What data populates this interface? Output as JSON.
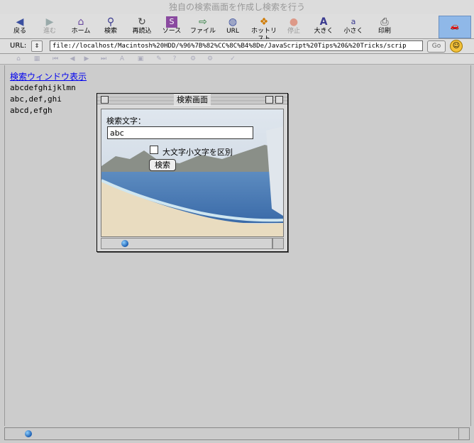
{
  "window": {
    "title": "独自の検索画面を作成し検索を行う"
  },
  "toolbar": {
    "buttons": [
      {
        "label": "戻る",
        "icon": "back-arrow-icon"
      },
      {
        "label": "進む",
        "icon": "forward-arrow-icon"
      },
      {
        "label": "ホーム",
        "icon": "home-icon"
      },
      {
        "label": "検索",
        "icon": "search-icon"
      },
      {
        "label": "再読込",
        "icon": "reload-icon"
      },
      {
        "label": "ソース",
        "icon": "source-icon"
      },
      {
        "label": "ファイル",
        "icon": "file-icon"
      },
      {
        "label": "URL",
        "icon": "url-icon"
      },
      {
        "label": "ホットリスト",
        "icon": "hotlist-icon"
      },
      {
        "label": "停止",
        "icon": "stop-icon"
      },
      {
        "label": "大きく",
        "icon": "bigger-icon"
      },
      {
        "label": "小さく",
        "icon": "smaller-icon"
      },
      {
        "label": "印刷",
        "icon": "print-icon"
      }
    ]
  },
  "urlbar": {
    "label": "URL:",
    "value": "file://localhost/Macintosh%20HDD/%96%7B%82%CC%8C%B4%8De/JavaScript%20Tips%20&%20Tricks/scrip",
    "go_label": "Go"
  },
  "page": {
    "link_text": "検索ウィンドウ表示",
    "lines": [
      "abcdefghijklmn",
      "abc,def,ghi",
      "abcd,efgh"
    ]
  },
  "popup": {
    "title": "検索画面",
    "form": {
      "label": "検索文字：",
      "input_value": "abc",
      "checkbox_label": "大文字小文字を区別",
      "button_label": "検索"
    }
  }
}
